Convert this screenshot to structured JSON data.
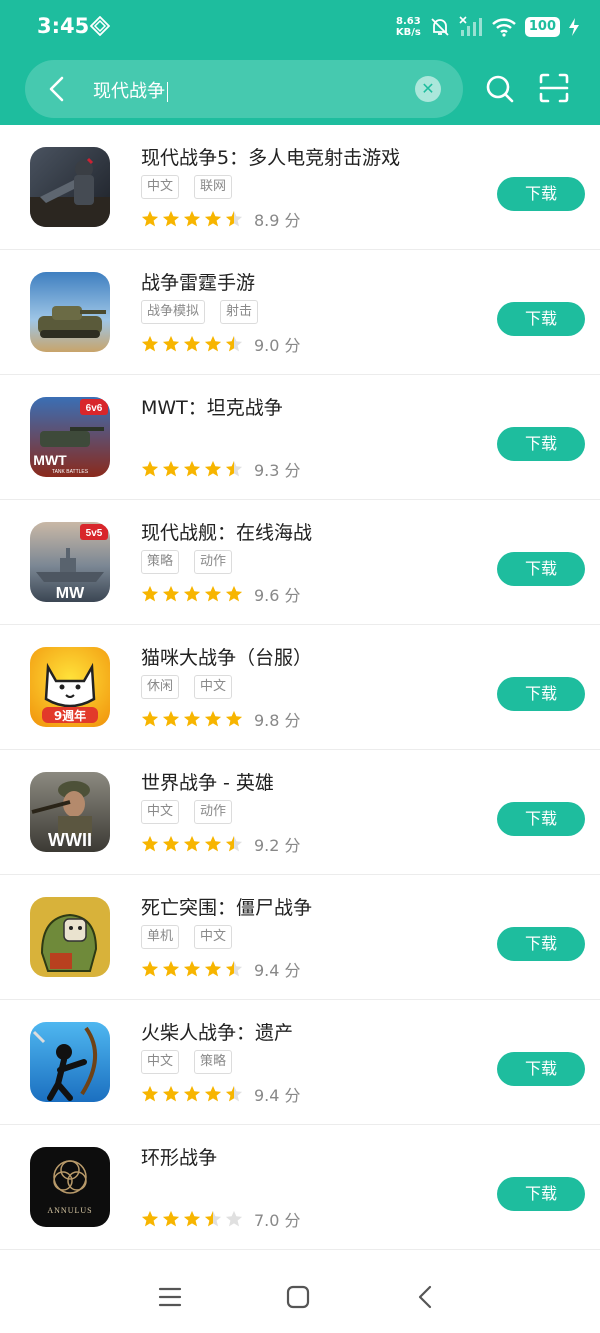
{
  "status": {
    "time": "3:45",
    "net_speed_value": "8.63",
    "net_speed_unit": "KB/s",
    "battery": "100"
  },
  "search": {
    "query": "现代战争"
  },
  "apps": [
    {
      "name": "现代战争5：多人电竞射击游戏",
      "tags": [
        "中文",
        "联网"
      ],
      "score": "8.9 分",
      "rating": 4.5,
      "button": "下载"
    },
    {
      "name": "战争雷霆手游",
      "tags": [
        "战争模拟",
        "射击"
      ],
      "score": "9.0 分",
      "rating": 4.5,
      "button": "下载"
    },
    {
      "name": "MWT：坦克战争",
      "tags": [],
      "score": "9.3 分",
      "rating": 4.5,
      "button": "下载"
    },
    {
      "name": "现代战舰：在线海战",
      "tags": [
        "策略",
        "动作"
      ],
      "score": "9.6 分",
      "rating": 5,
      "button": "下载"
    },
    {
      "name": "猫咪大战争（台服）",
      "tags": [
        "休闲",
        "中文"
      ],
      "score": "9.8 分",
      "rating": 5,
      "button": "下载"
    },
    {
      "name": "世界战争 - 英雄",
      "tags": [
        "中文",
        "动作"
      ],
      "score": "9.2 分",
      "rating": 4.5,
      "button": "下载"
    },
    {
      "name": "死亡突围：僵尸战争",
      "tags": [
        "单机",
        "中文"
      ],
      "score": "9.4 分",
      "rating": 4.5,
      "button": "下载"
    },
    {
      "name": "火柴人战争：遗产",
      "tags": [
        "中文",
        "策略"
      ],
      "score": "9.4 分",
      "rating": 4.5,
      "button": "下载"
    },
    {
      "name": "环形战争",
      "tags": [],
      "score": "7.0 分",
      "rating": 3.5,
      "button": "下载"
    }
  ],
  "icon_labels": {
    "mwt_badge": "6v6",
    "mwt_logo": "MWT",
    "mwt_sub": "TANK BATTLES",
    "mw_badge": "5v5",
    "mw_logo": "MW",
    "cat_banner": "9週年",
    "wwii_logo": "WWII",
    "annulus_logo": "ANNULUS"
  },
  "colors": {
    "accent": "#1ebd9e",
    "star": "#f7b500",
    "star_empty": "#e0e0e0"
  }
}
